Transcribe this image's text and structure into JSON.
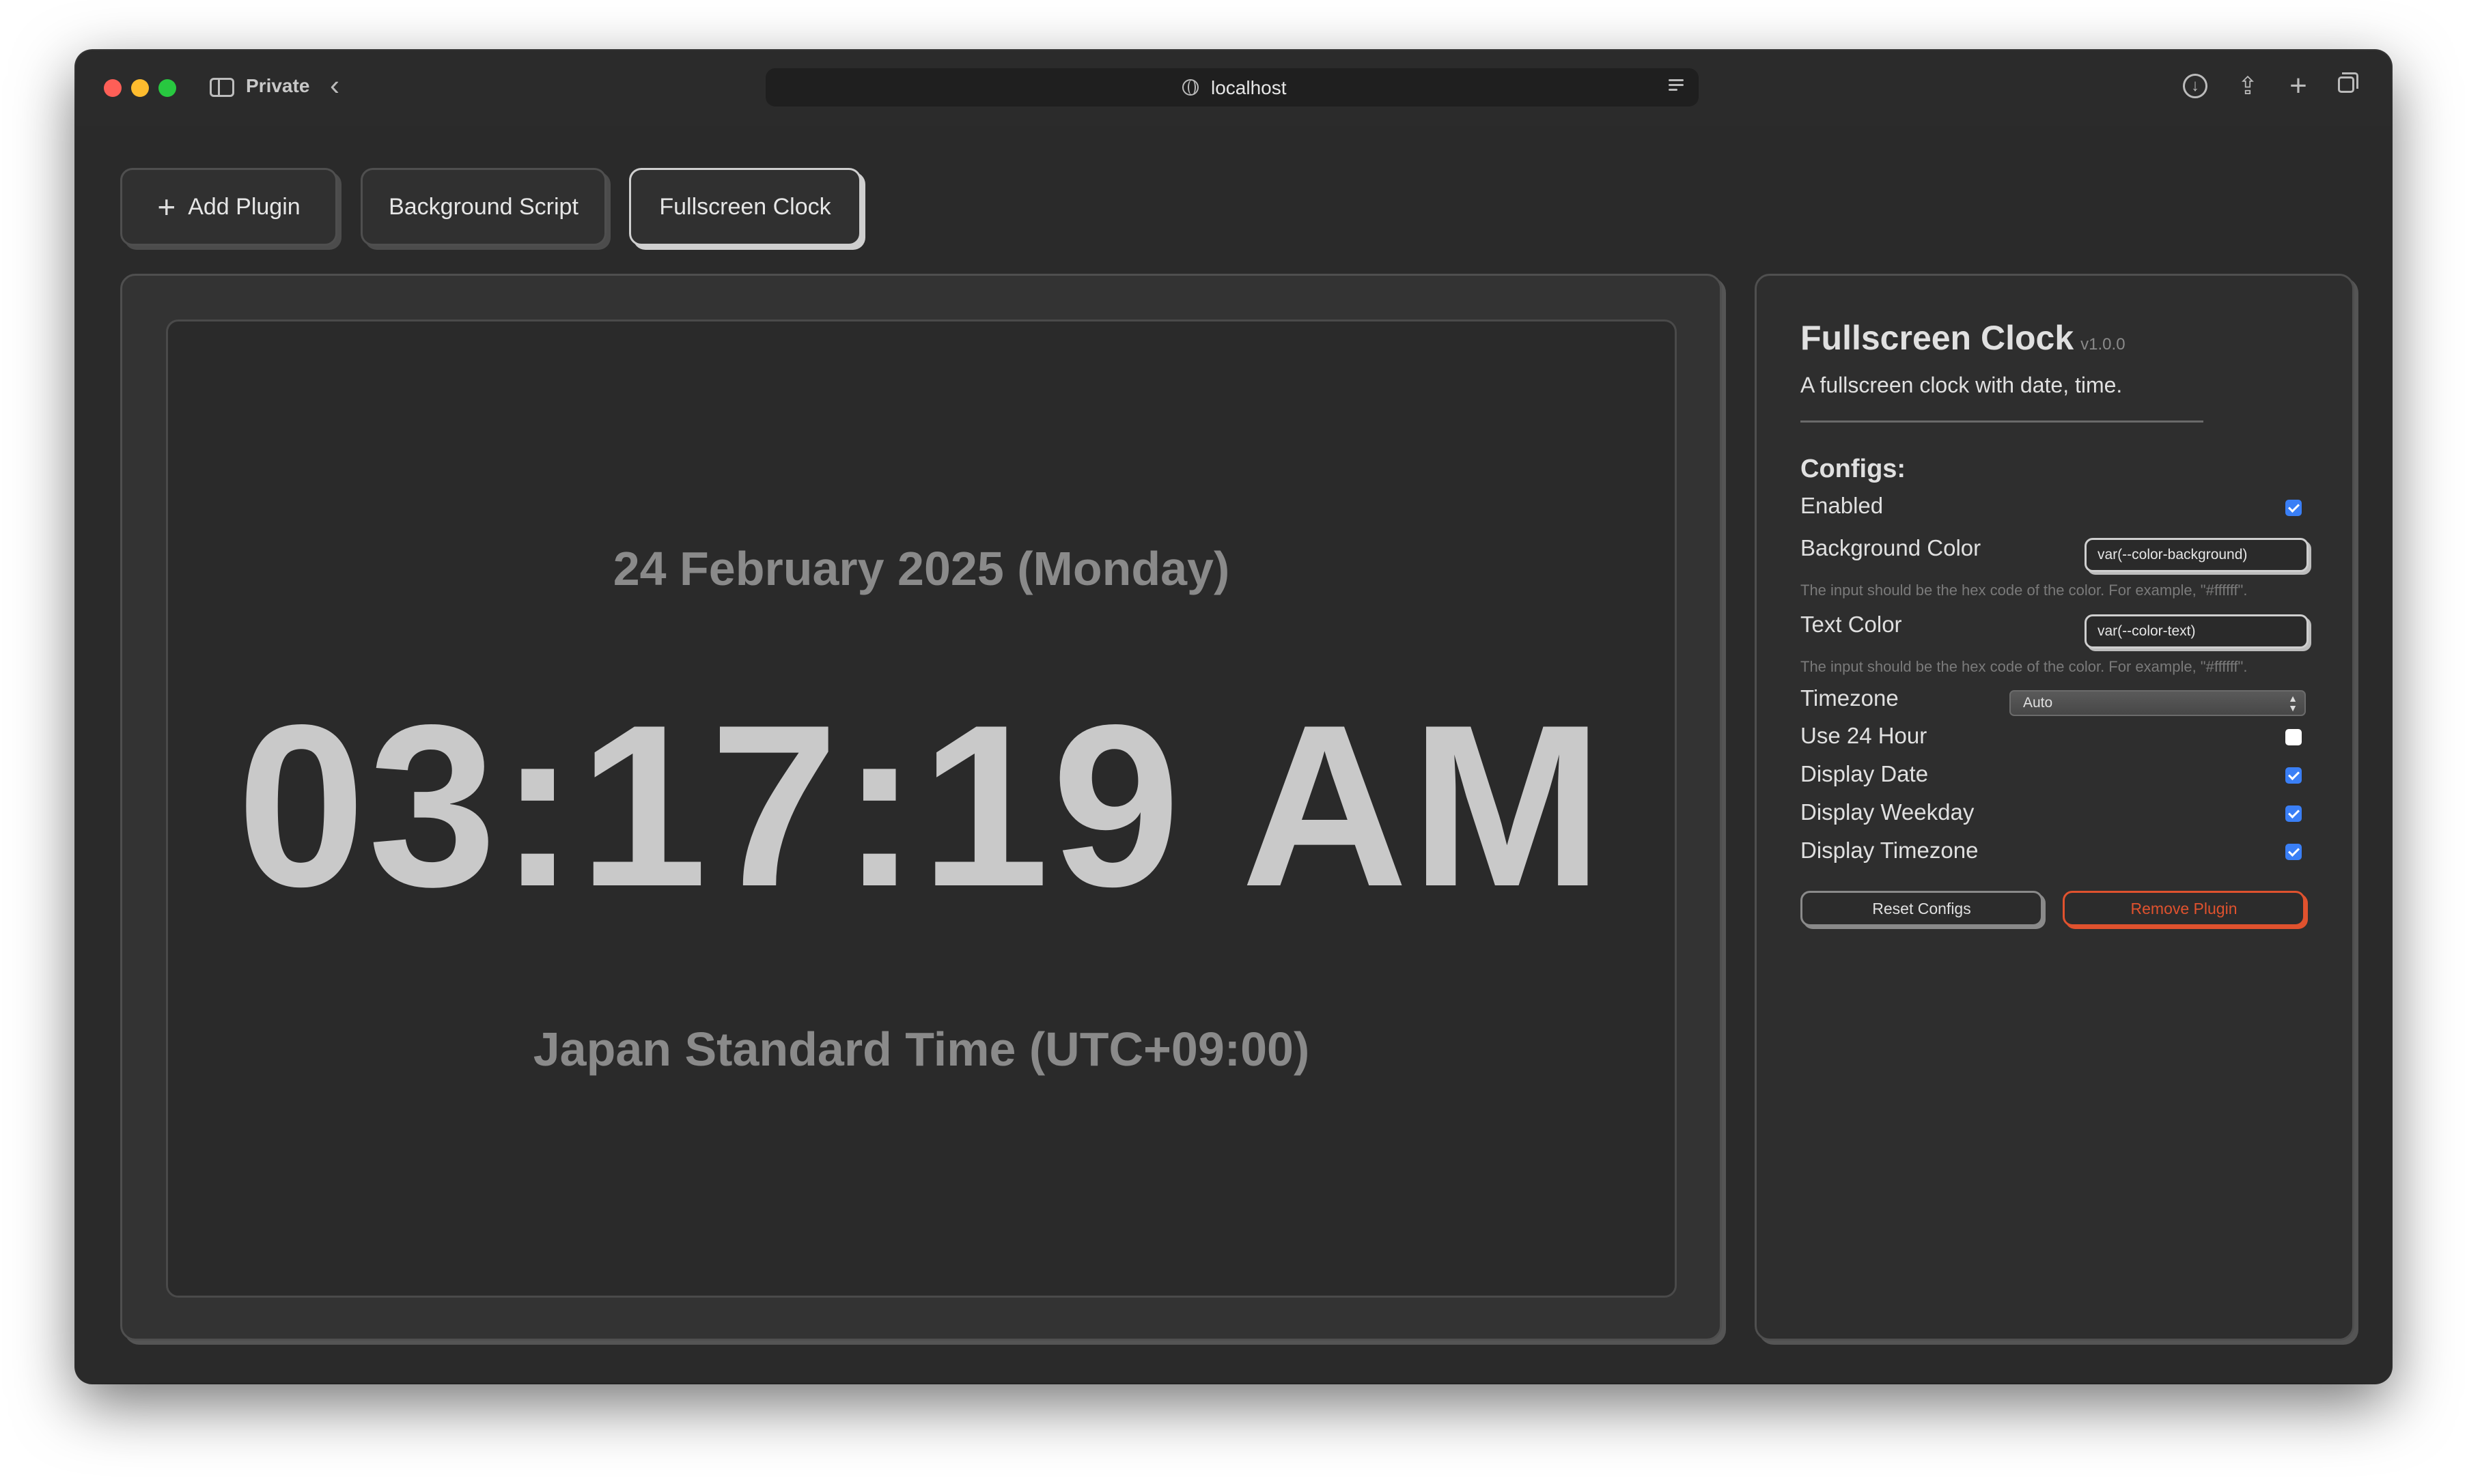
{
  "browser": {
    "private_label": "Private",
    "url": "localhost"
  },
  "toolbar": {
    "add_plugin_label": "Add Plugin",
    "background_script_label": "Background Script",
    "fullscreen_clock_label": "Fullscreen Clock"
  },
  "clock": {
    "date_text": "24 February 2025 (Monday)",
    "time_text": "03:17:19 AM",
    "timezone_text": "Japan Standard Time (UTC+09:00)"
  },
  "plugin": {
    "title": "Fullscreen Clock",
    "version": "v1.0.0",
    "description": "A fullscreen clock with date, time.",
    "configs_heading": "Configs:",
    "enabled_label": "Enabled",
    "enabled": true,
    "background_color_label": "Background Color",
    "background_color_value": "var(--color-background)",
    "background_color_hint": "The input should be the hex code of the color. For example, \"#ffffff\".",
    "text_color_label": "Text Color",
    "text_color_value": "var(--color-text)",
    "text_color_hint": "The input should be the hex code of the color. For example, \"#ffffff\".",
    "timezone_label": "Timezone",
    "timezone_value": "Auto",
    "use_24_hour_label": "Use 24 Hour",
    "use_24_hour": false,
    "display_date_label": "Display Date",
    "display_date": true,
    "display_weekday_label": "Display Weekday",
    "display_weekday": true,
    "display_timezone_label": "Display Timezone",
    "display_timezone": true,
    "reset_label": "Reset Configs",
    "remove_label": "Remove Plugin"
  },
  "colors": {
    "accent": "#3a7ff6",
    "danger": "#e0522e",
    "window_background": "#2a2a2a"
  }
}
